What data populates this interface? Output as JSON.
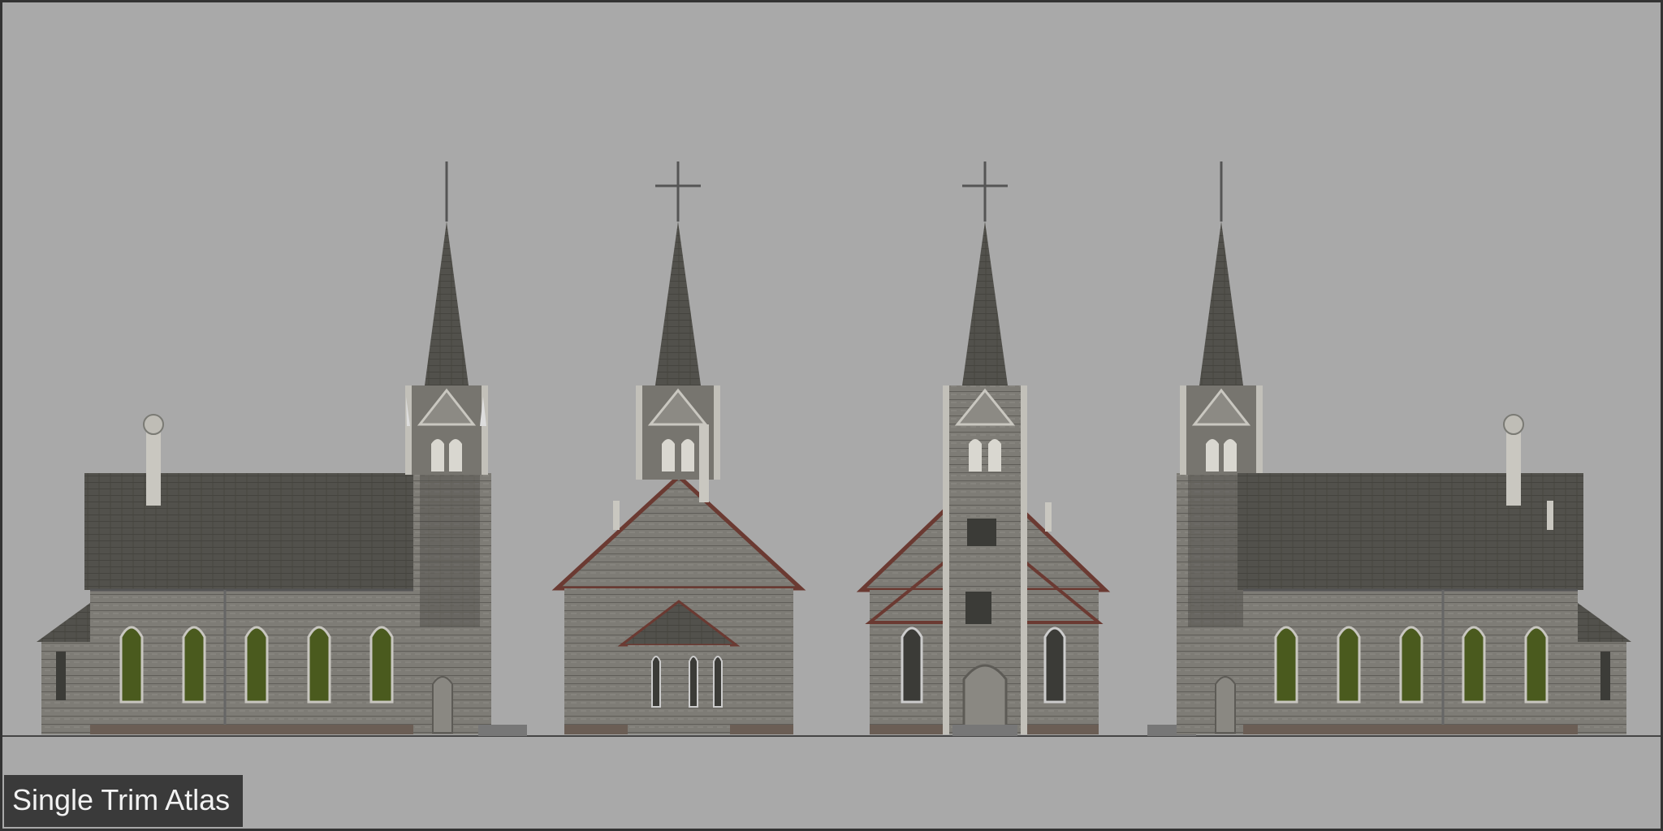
{
  "caption": {
    "label": "Single Trim Atlas"
  },
  "colors": {
    "background": "#a9a9a9",
    "wall": "#7d7b75",
    "roof": "#52514c",
    "window_glass": "#4a5a1e",
    "trim_red": "#6b3a32",
    "caption_bg": "#3a3a3a"
  },
  "views": [
    {
      "name": "side-left",
      "icon": "church-left-elevation"
    },
    {
      "name": "rear",
      "icon": "church-rear-elevation"
    },
    {
      "name": "front",
      "icon": "church-front-elevation"
    },
    {
      "name": "side-right",
      "icon": "church-right-elevation"
    }
  ]
}
